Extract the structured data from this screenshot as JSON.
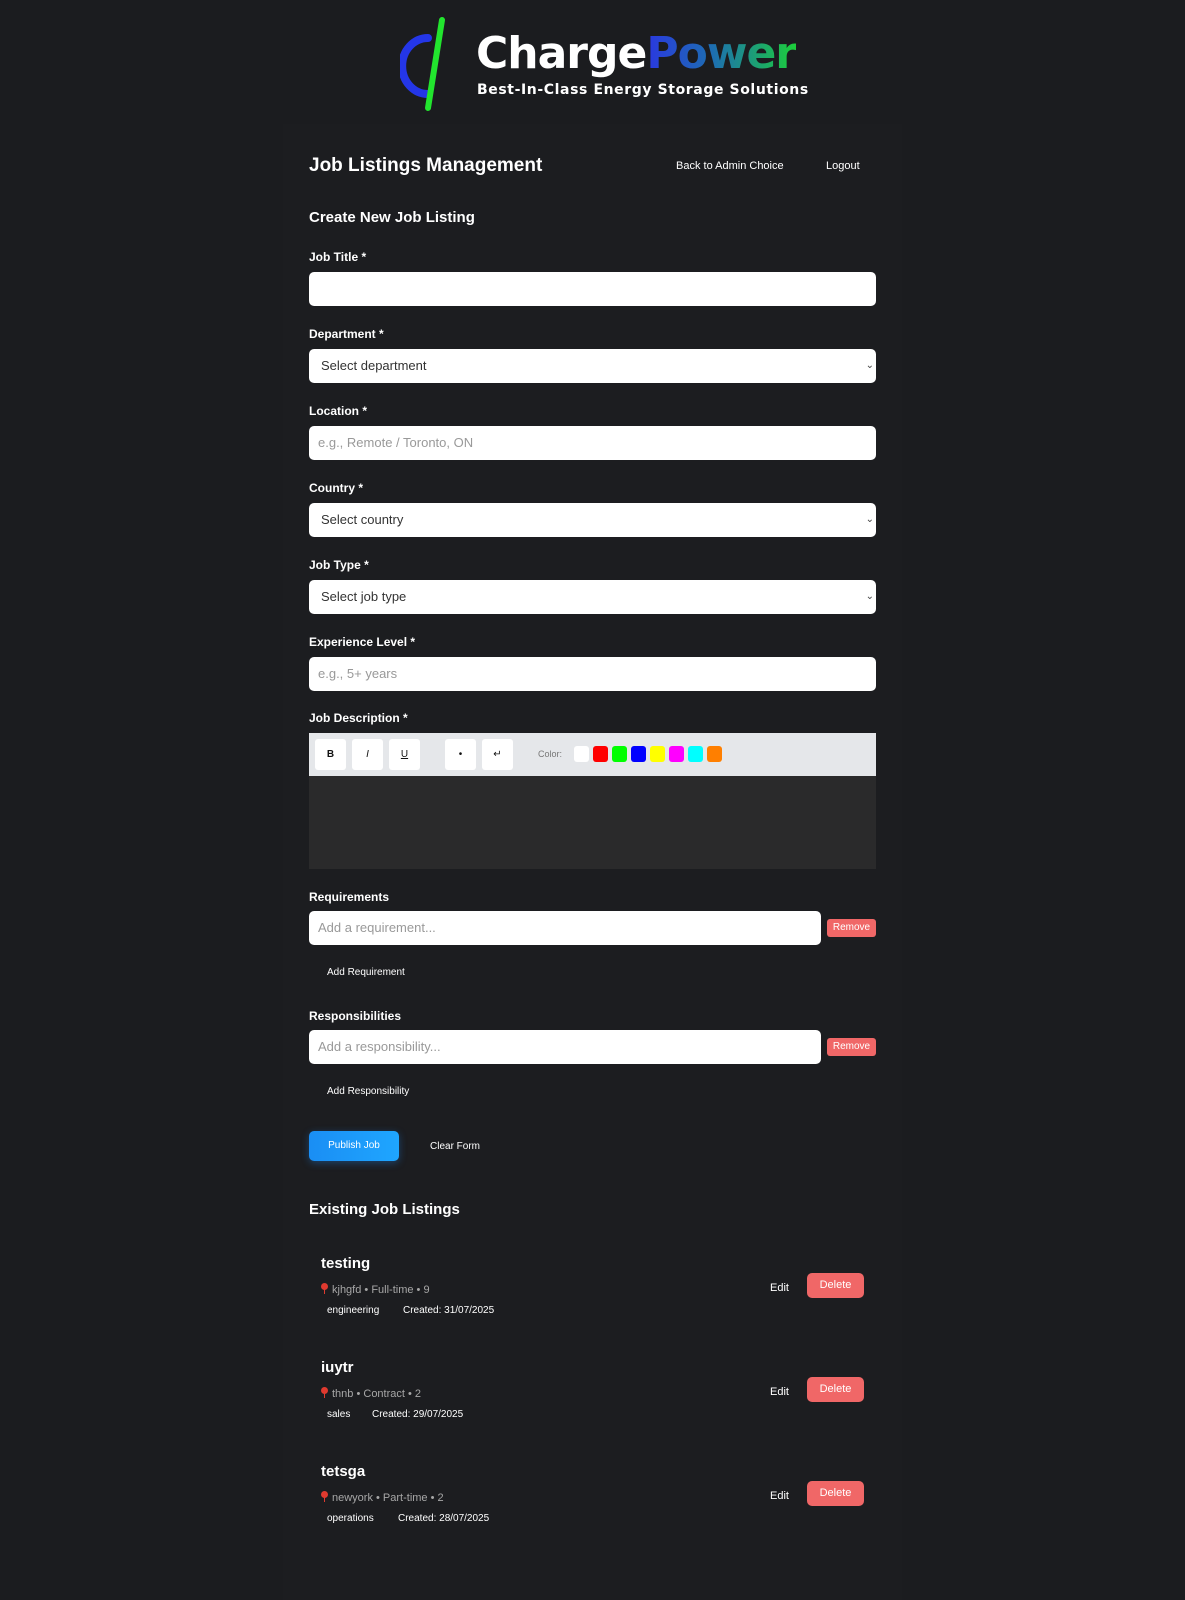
{
  "brand": {
    "name_part1": "Charge",
    "name_part2": "Power",
    "tagline": "Best-In-Class Energy Storage Solutions"
  },
  "header": {
    "title": "Job Listings Management",
    "back_link": "Back to Admin Choice",
    "logout": "Logout"
  },
  "form": {
    "section_title": "Create New Job Listing",
    "job_title": {
      "label": "Job Title *",
      "value": ""
    },
    "department": {
      "label": "Department *",
      "selected": "Select department"
    },
    "location": {
      "label": "Location *",
      "placeholder": "e.g., Remote / Toronto, ON"
    },
    "country": {
      "label": "Country *",
      "selected": "Select country"
    },
    "job_type": {
      "label": "Job Type *",
      "selected": "Select job type"
    },
    "experience": {
      "label": "Experience Level *",
      "placeholder": "e.g., 5+ years"
    },
    "description": {
      "label": "Job Description *",
      "toolbar": {
        "bold": "B",
        "italic": "I",
        "underline": "U",
        "bullet": "•",
        "break": "↵",
        "color_label": "Color:"
      },
      "colors": [
        "#ffffff",
        "#ff0000",
        "#00ff00",
        "#0000ff",
        "#ffff00",
        "#ff00ff",
        "#00ffff",
        "#ff7f00"
      ]
    },
    "requirements": {
      "label": "Requirements",
      "placeholder": "Add a requirement...",
      "remove": "Remove",
      "add": "Add Requirement"
    },
    "responsibilities": {
      "label": "Responsibilities",
      "placeholder": "Add a responsibility...",
      "remove": "Remove",
      "add": "Add Responsibility"
    },
    "publish": "Publish Job",
    "clear": "Clear Form"
  },
  "listings": {
    "title": "Existing Job Listings",
    "edit": "Edit",
    "delete": "Delete",
    "jobs": [
      {
        "title": "testing",
        "meta": "kjhgfd • Full-time • 9",
        "department": "engineering",
        "created": "Created: 31/07/2025"
      },
      {
        "title": "iuytr",
        "meta": "thnb • Contract • 2",
        "department": "sales",
        "created": "Created: 29/07/2025"
      },
      {
        "title": "tetsga",
        "meta": "newyork • Part-time • 2",
        "department": "operations",
        "created": "Created: 28/07/2025"
      }
    ]
  }
}
